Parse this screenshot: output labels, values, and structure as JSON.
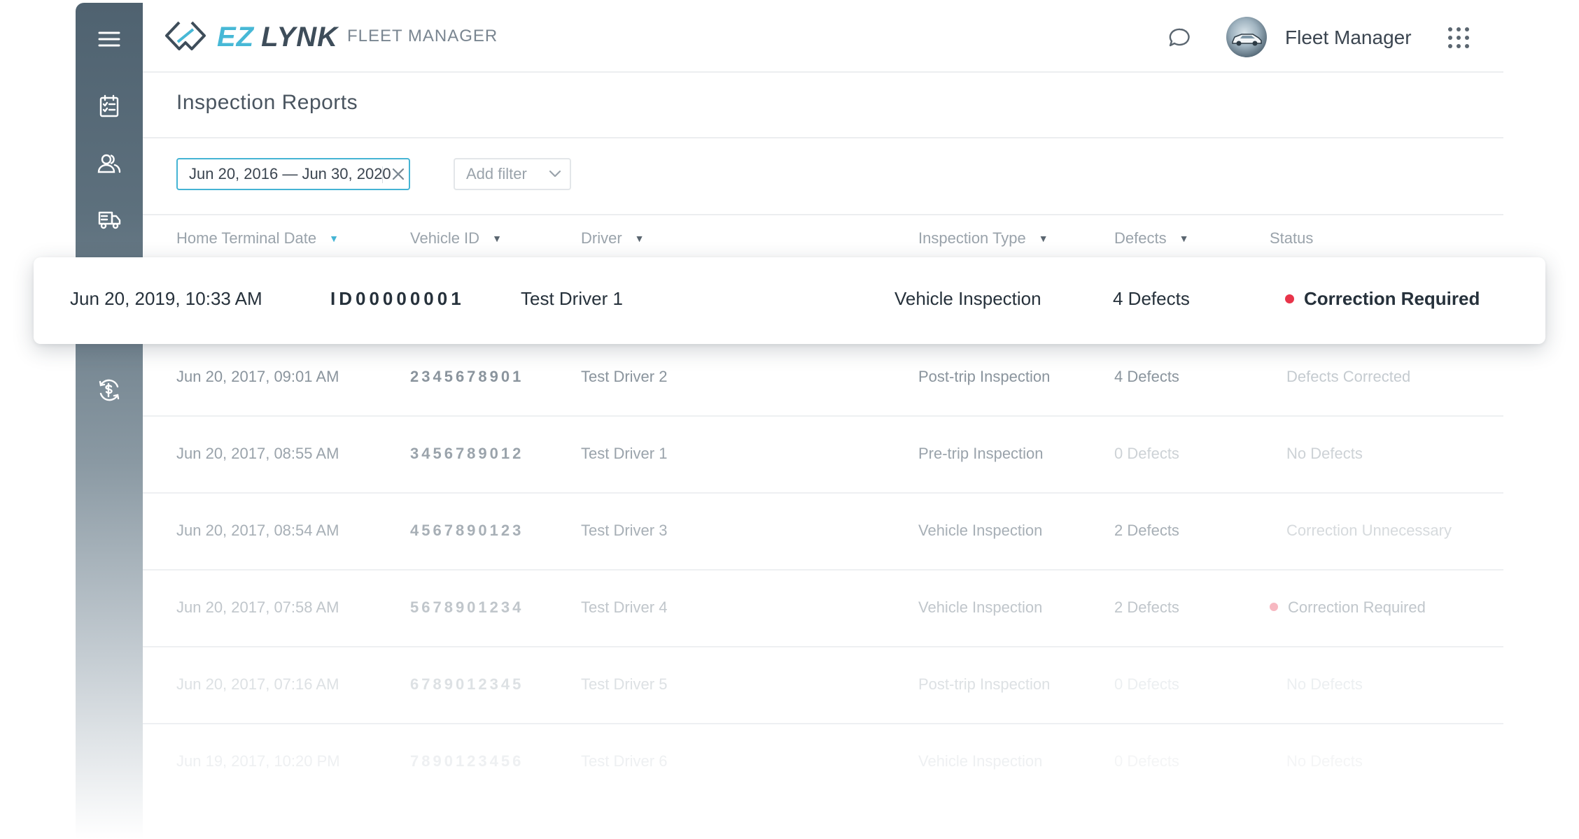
{
  "app": {
    "logo_ez": "EZ",
    "logo_lynk": "LYNK",
    "subtitle": "FLEET MANAGER",
    "user_name": "Fleet Manager"
  },
  "sidebar": {
    "items": [
      {
        "icon": "menu-icon"
      },
      {
        "icon": "checklist-icon"
      },
      {
        "icon": "users-icon"
      },
      {
        "icon": "truck-icon"
      },
      {
        "icon": "billing-icon"
      }
    ]
  },
  "page": {
    "title": "Inspection Reports"
  },
  "filters": {
    "date_range": "Jun 20, 2016 — Jun 30, 2020",
    "add_filter": "Add filter"
  },
  "table": {
    "columns": [
      {
        "label": "Home Terminal Date",
        "sortable": true,
        "active": true
      },
      {
        "label": "Vehicle ID",
        "sortable": true
      },
      {
        "label": "Driver",
        "sortable": true
      },
      {
        "label": "Inspection Type",
        "sortable": true
      },
      {
        "label": "Defects",
        "sortable": true
      },
      {
        "label": "Status",
        "sortable": false
      }
    ],
    "highlighted_row": {
      "date": "Jun 20, 2019, 10:33 AM",
      "vehicle_id": "ID00000001",
      "driver": "Test Driver 1",
      "type": "Vehicle Inspection",
      "defects": "4 Defects",
      "status": "Correction Required",
      "status_color": "#e8344a"
    },
    "rows": [
      {
        "date": "Jun 20, 2017, 09:01 AM",
        "vehicle_id": "2345678901",
        "driver": "Test Driver 2",
        "type": "Post-trip Inspection",
        "defects": "4 Defects",
        "status": "Defects Corrected"
      },
      {
        "date": "Jun 20, 2017, 08:55 AM",
        "vehicle_id": "3456789012",
        "driver": "Test Driver 1",
        "type": "Pre-trip Inspection",
        "defects": "0 Defects",
        "status": "No Defects"
      },
      {
        "date": "Jun 20, 2017, 08:54 AM",
        "vehicle_id": "4567890123",
        "driver": "Test Driver 3",
        "type": "Vehicle Inspection",
        "defects": "2 Defects",
        "status": "Correction Unnecessary"
      },
      {
        "date": "Jun 20, 2017, 07:58 AM",
        "vehicle_id": "5678901234",
        "driver": "Test Driver 4",
        "type": "Vehicle Inspection",
        "defects": "2 Defects",
        "status": "Correction Required"
      },
      {
        "date": "Jun 20, 2017, 07:16 AM",
        "vehicle_id": "6789012345",
        "driver": "Test Driver 5",
        "type": "Post-trip Inspection",
        "defects": "0 Defects",
        "status": "No Defects"
      },
      {
        "date": "Jun 19, 2017, 10:20 PM",
        "vehicle_id": "7890123456",
        "driver": "Test Driver 6",
        "type": "Vehicle Inspection",
        "defects": "0 Defects",
        "status": "No Defects"
      }
    ]
  },
  "colors": {
    "accent": "#45b4d4",
    "brand_dark": "#3e4d5a",
    "status_red": "#e8344a",
    "sidebar": "#4f6270"
  }
}
